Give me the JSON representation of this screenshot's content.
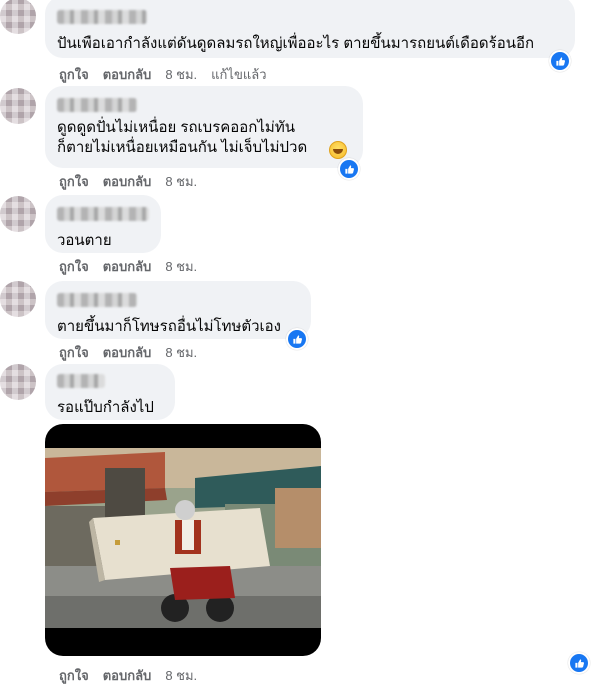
{
  "comments": [
    {
      "lines": [
        "ปันเพือเอากำลังแต่ดันดูดลมรถใหญ่เพื่ออะไร ตายขึ้นมารถยนต์เดือดร้อนอีก"
      ],
      "actions": {
        "like": "ถูกใจ",
        "reply": "ตอบกลับ",
        "time": "8 ชม.",
        "edited": "แก้ไขแล้ว"
      }
    },
    {
      "lines": [
        "ดูดดูดปั่นไม่เหนื่อย รถเบรคออกไม่ทัน",
        "ก็ตายไม่เหนื่อยเหมือนกัน ไม่เจ็บไม่ปวด"
      ],
      "actions": {
        "like": "ถูกใจ",
        "reply": "ตอบกลับ",
        "time": "8 ชม."
      }
    },
    {
      "lines": [
        "วอนตาย"
      ],
      "actions": {
        "like": "ถูกใจ",
        "reply": "ตอบกลับ",
        "time": "8 ชม."
      }
    },
    {
      "lines": [
        "ตายขึ้นมาก็โทษรถอื่นไม่โทษตัวเอง"
      ],
      "actions": {
        "like": "ถูกใจ",
        "reply": "ตอบกลับ",
        "time": "8 ชม."
      }
    },
    {
      "lines": [
        "รอแป๊บกำลังไป"
      ],
      "actions": {
        "like": "ถูกใจ",
        "reply": "ตอบกลับ",
        "time": "8 ชม."
      }
    }
  ],
  "last_actions": {
    "like": "ถูกใจ",
    "reply": "ตอบกลับ",
    "time": "8 ชม."
  },
  "icons": {
    "reaction": "like-reaction-icon",
    "emoji": "laughing-emoji-icon"
  },
  "colors": {
    "bubble": "#f0f2f5",
    "reaction": "#1877f2",
    "meta": "#65676b"
  }
}
